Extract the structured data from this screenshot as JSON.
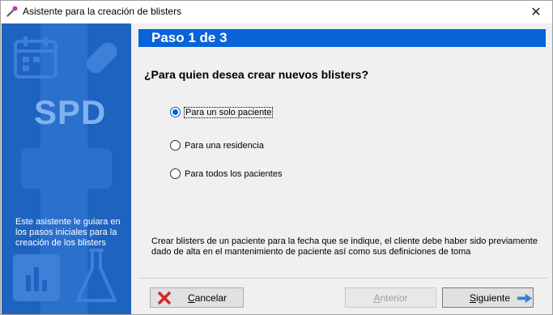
{
  "window": {
    "title": "Asistente para la creación de blisters",
    "close_glyph": "✕"
  },
  "sidebar": {
    "logo_text": "SPD",
    "description": "Este asistente le guiara en los pasos iniciales para la creación de los blisters"
  },
  "step": {
    "header": "Paso 1 de 3",
    "question": "¿Para quien desea crear nuevos blisters?"
  },
  "options": [
    {
      "label": "Para un solo paciente",
      "selected": true
    },
    {
      "label": "Para una residencia",
      "selected": false
    },
    {
      "label": "Para todos los pacientes",
      "selected": false
    }
  ],
  "info": "Crear blisters de un paciente para la fecha que se indique, el cliente debe haber sido previamente dado de alta en el mantenimiento de paciente así como sus definiciones de toma",
  "buttons": {
    "cancel": {
      "label_prefix": "",
      "label_mnemonic": "C",
      "label_rest": "ancelar",
      "icon": "red-x-icon",
      "enabled": true
    },
    "previous": {
      "label_mnemonic": "A",
      "label_rest": "nterior",
      "enabled": false
    },
    "next": {
      "label_mnemonic": "S",
      "label_rest": "iguiente",
      "icon": "blue-arrow-right-icon",
      "enabled": true
    }
  },
  "colors": {
    "sidebar": "#1e63c0",
    "header": "#0a63d8",
    "radio_selected": "#0a5fd1",
    "cancel_icon": "#d6262b",
    "next_icon": "#2e86d8"
  }
}
